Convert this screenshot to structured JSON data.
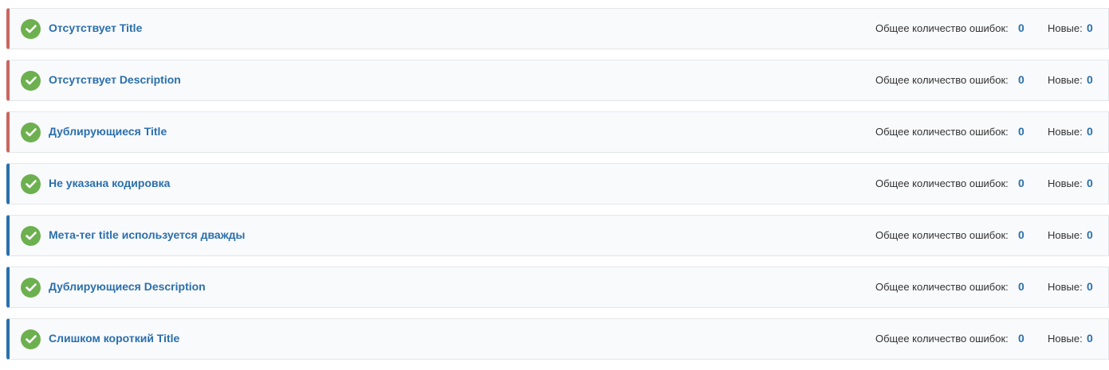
{
  "colors": {
    "accent_red": "#c9665f",
    "accent_blue": "#2a6fac",
    "check_green": "#6db04f",
    "link_blue": "#2a6fac"
  },
  "labels": {
    "total_errors": "Общее количество ошибок:",
    "new_errors": "Новые:"
  },
  "checks": [
    {
      "title": "Отсутствует Title",
      "severity": "red",
      "icon": "check-circle-icon",
      "total": "0",
      "new": "0"
    },
    {
      "title": "Отсутствует Description",
      "severity": "red",
      "icon": "check-circle-icon",
      "total": "0",
      "new": "0"
    },
    {
      "title": "Дублирующиеся Title",
      "severity": "red",
      "icon": "check-circle-icon",
      "total": "0",
      "new": "0"
    },
    {
      "title": "Не указана кодировка",
      "severity": "blue",
      "icon": "check-circle-icon",
      "total": "0",
      "new": "0"
    },
    {
      "title": "Мета-тег title используется дважды",
      "severity": "blue",
      "icon": "check-circle-icon",
      "total": "0",
      "new": "0"
    },
    {
      "title": "Дублирующиеся Description",
      "severity": "blue",
      "icon": "check-circle-icon",
      "total": "0",
      "new": "0"
    },
    {
      "title": "Слишком короткий Title",
      "severity": "blue",
      "icon": "check-circle-icon",
      "total": "0",
      "new": "0"
    }
  ]
}
